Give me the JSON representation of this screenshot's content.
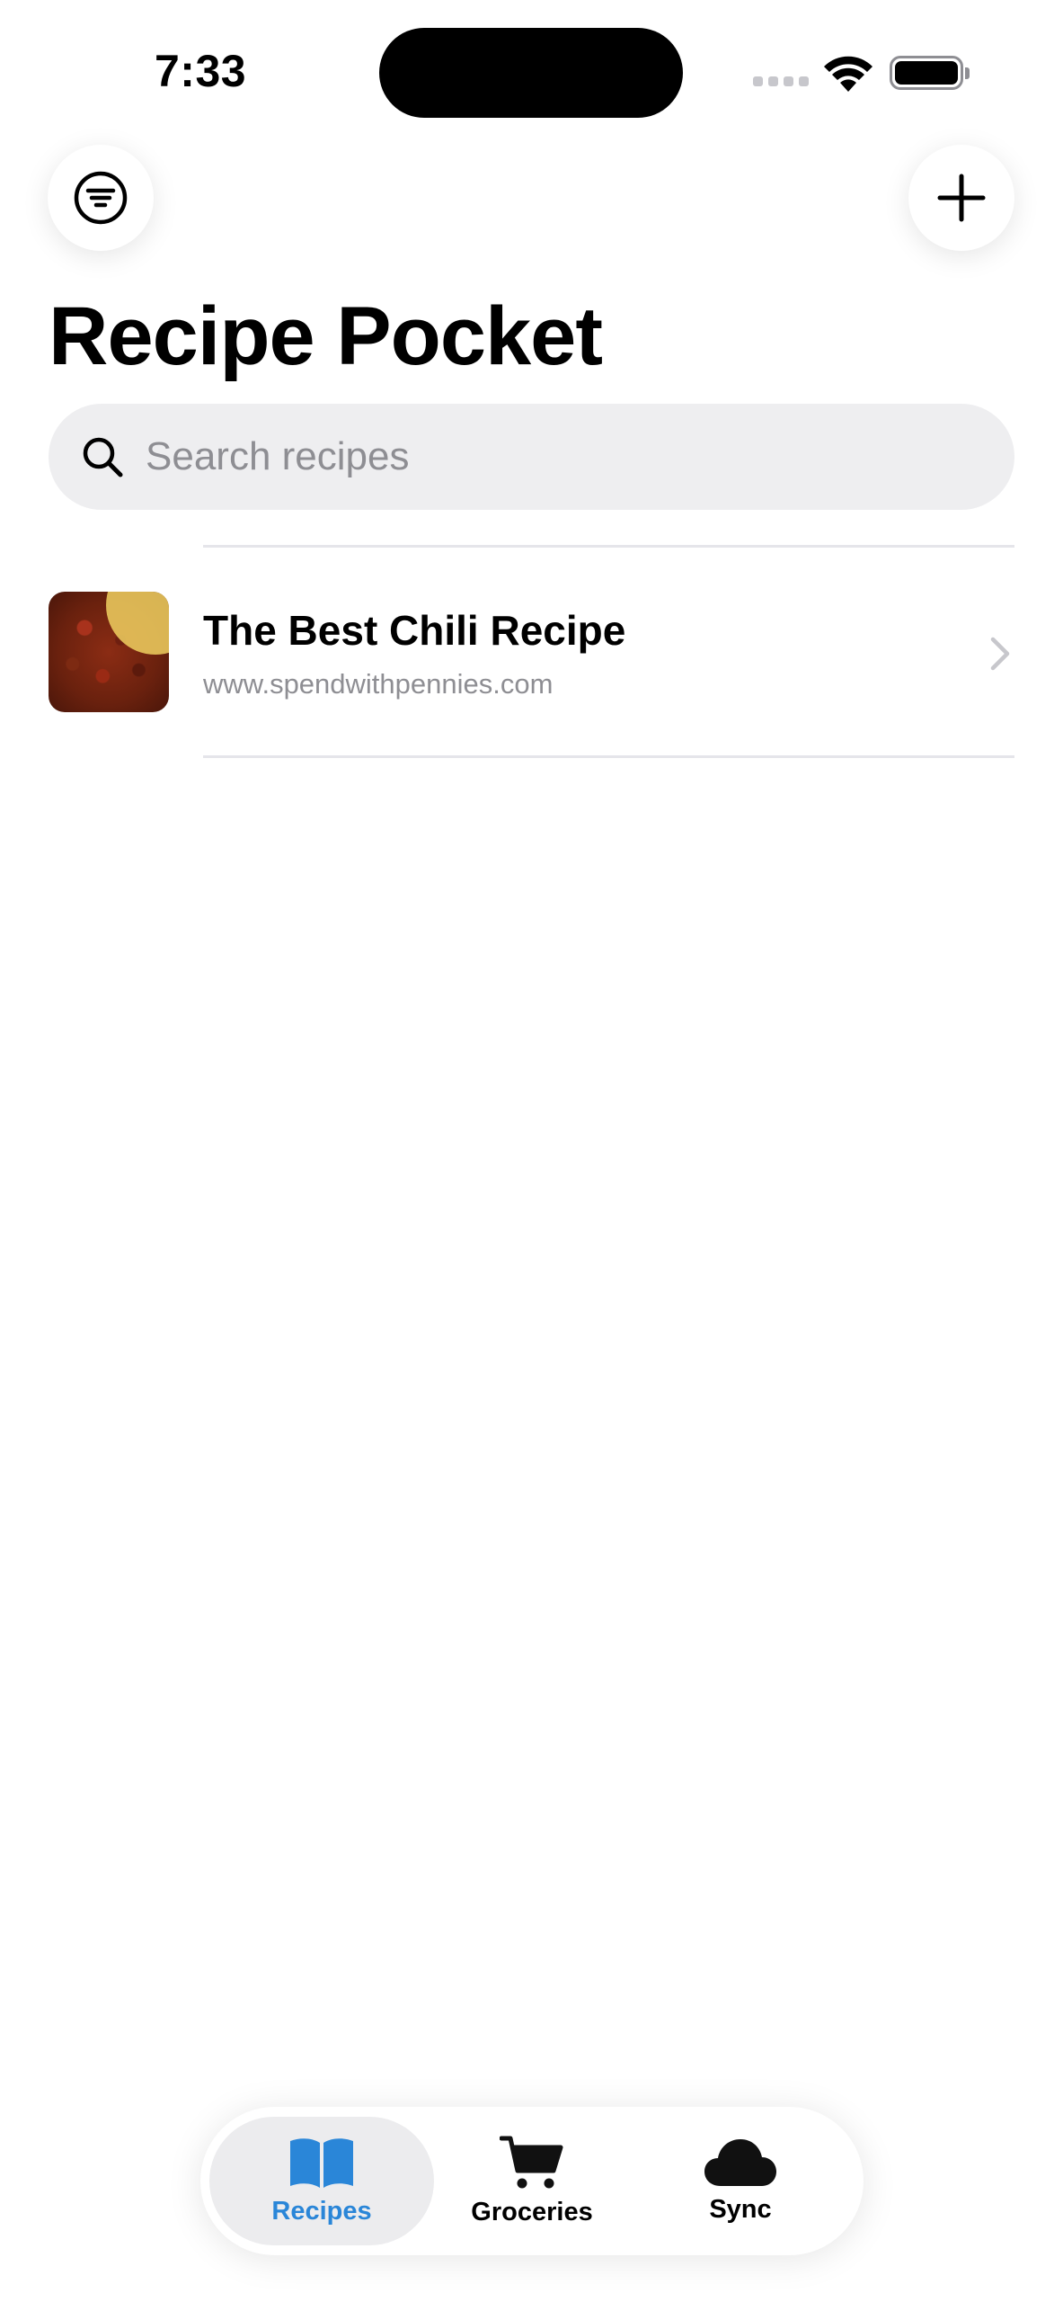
{
  "status_bar": {
    "time": "7:33"
  },
  "app": {
    "title": "Recipe Pocket"
  },
  "search": {
    "placeholder": "Search recipes",
    "value": ""
  },
  "recipes": [
    {
      "title": "The Best Chili Recipe",
      "source": "www.spendwithpennies.com"
    }
  ],
  "tab_bar": {
    "tabs": [
      {
        "label": "Recipes",
        "icon": "book-icon",
        "active": true
      },
      {
        "label": "Groceries",
        "icon": "cart-icon",
        "active": false
      },
      {
        "label": "Sync",
        "icon": "cloud-icon",
        "active": false
      }
    ]
  },
  "colors": {
    "accent": "#2a86d8",
    "search_bg": "#eeeef0",
    "secondary_text": "#8e8e93"
  }
}
